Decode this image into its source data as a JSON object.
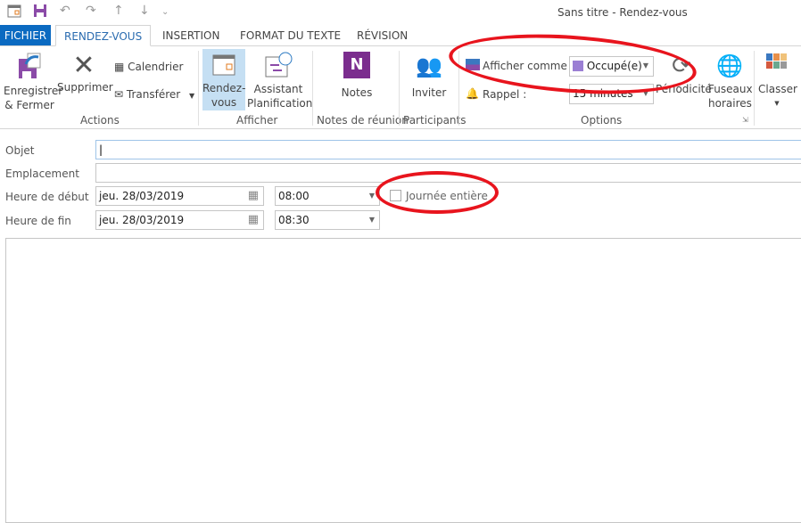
{
  "window": {
    "title": "Sans titre - Rendez-vous"
  },
  "quick_access": [
    "calendar-icon",
    "save-icon",
    "undo-icon",
    "redo-icon",
    "up-icon",
    "down-icon",
    "customize-icon"
  ],
  "tabs": [
    {
      "label": "FICHIER"
    },
    {
      "label": "RENDEZ-VOUS"
    },
    {
      "label": "INSERTION"
    },
    {
      "label": "FORMAT DU TEXTE"
    },
    {
      "label": "RÉVISION"
    }
  ],
  "ribbon": {
    "actions": {
      "save_close": [
        "Enregistrer",
        "& Fermer"
      ],
      "delete": "Supprimer",
      "calendar": "Calendrier",
      "forward": "Transférer",
      "group": "Actions"
    },
    "show": {
      "appointment": [
        "Rendez-",
        "vous"
      ],
      "scheduling": [
        "Assistant",
        "Planification"
      ],
      "group": "Afficher"
    },
    "notes": {
      "label": "Notes",
      "group": "Notes de réunion"
    },
    "participants": {
      "invite": "Inviter",
      "group": "Participants"
    },
    "options": {
      "show_as_label": "Afficher comme :",
      "show_as_value": "Occupé(e)",
      "show_as_color": "#9b7fd4",
      "reminder_label": "Rappel :",
      "reminder_value": "15 minutes",
      "recurrence": "Périodicité",
      "timezones": [
        "Fuseaux",
        "horaires"
      ],
      "group": "Options"
    },
    "classify": {
      "label": "Classer"
    }
  },
  "form": {
    "subject_label": "Objet",
    "subject_value": "",
    "location_label": "Emplacement",
    "location_value": "",
    "start_label": "Heure de début",
    "start_date": "jeu. 28/03/2019",
    "start_time": "08:00",
    "end_label": "Heure de fin",
    "end_date": "jeu. 28/03/2019",
    "end_time": "08:30",
    "all_day_label": "Journée entière",
    "all_day_checked": false
  },
  "annotation_color": "#e8141d"
}
